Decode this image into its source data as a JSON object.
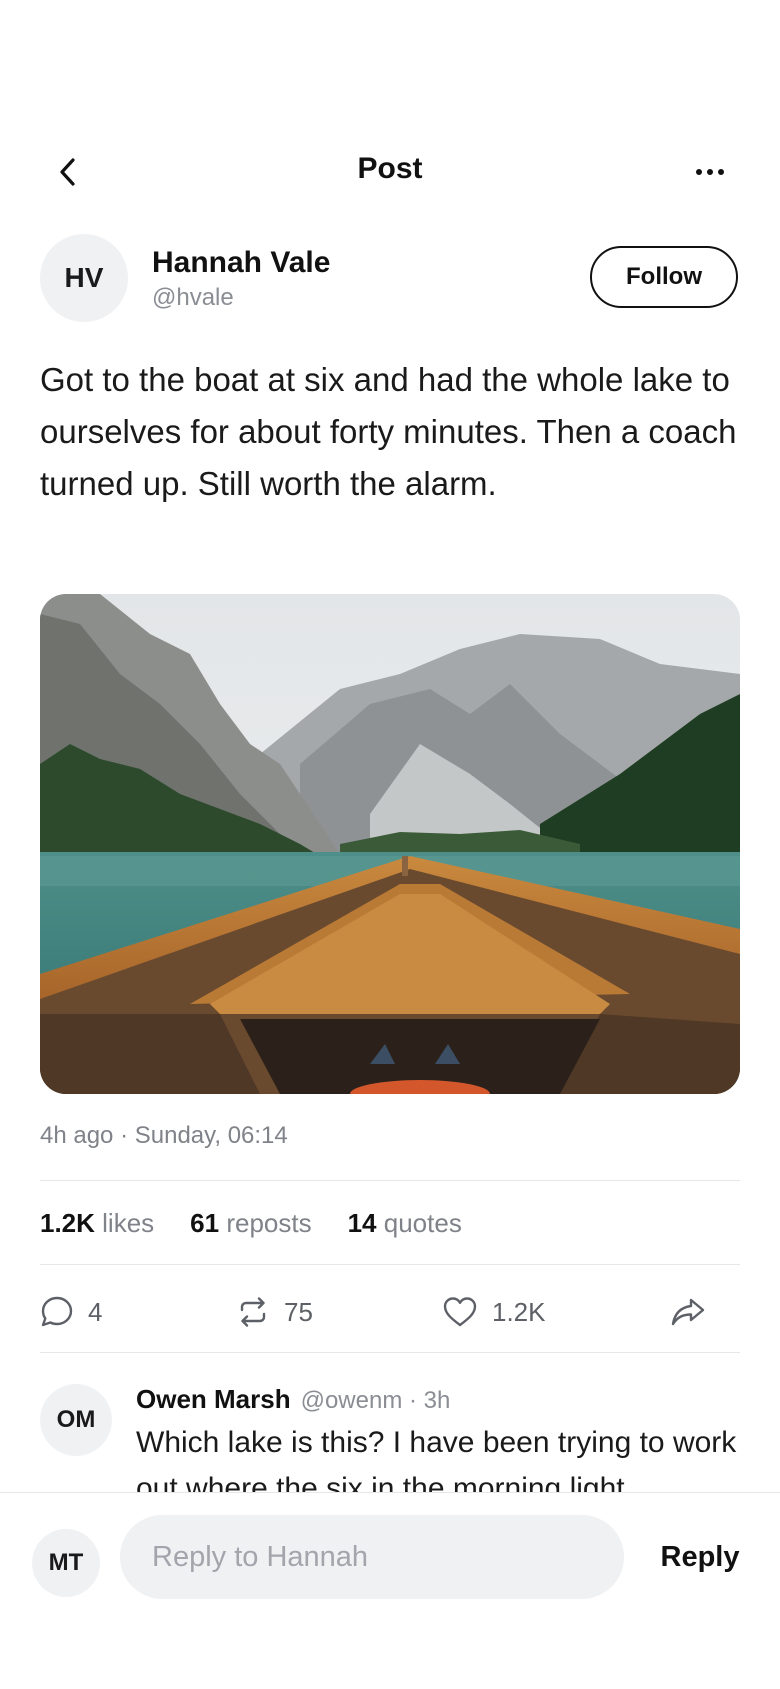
{
  "header": {
    "title": "Post",
    "back_icon": "chevron-left-icon",
    "more_icon": "more-horizontal-icon"
  },
  "author": {
    "initials": "HV",
    "name": "Hannah Vale",
    "handle": "@hvale",
    "follow_label": "Follow"
  },
  "post": {
    "text": "Got to the boat at six and had the whole lake to ourselves for about forty minutes. Then a coach turned up. Still worth the alarm.",
    "timestamp": "4h ago · Sunday, 06:14"
  },
  "stats": [
    {
      "count": "1.2K",
      "label": "likes"
    },
    {
      "count": "61",
      "label": "reposts"
    },
    {
      "count": "14",
      "label": "quotes"
    }
  ],
  "actions": {
    "comments": "4",
    "reposts": "75",
    "likes": "1.2K",
    "icons": [
      "comment-icon",
      "repost-icon",
      "heart-icon",
      "share-icon"
    ]
  },
  "comment": {
    "initials": "OM",
    "name": "Owen Marsh",
    "meta": "@owenm · 3h",
    "text": "Which lake is this? I have been trying to work out where the six in the morning light"
  },
  "reply": {
    "initials": "MT",
    "placeholder": "Reply to Hannah",
    "button_label": "Reply"
  },
  "colors": {
    "text": "#111111",
    "muted": "#7f8288",
    "avatar_bg": "#f0f1f3",
    "divider": "#e6e7ea"
  }
}
